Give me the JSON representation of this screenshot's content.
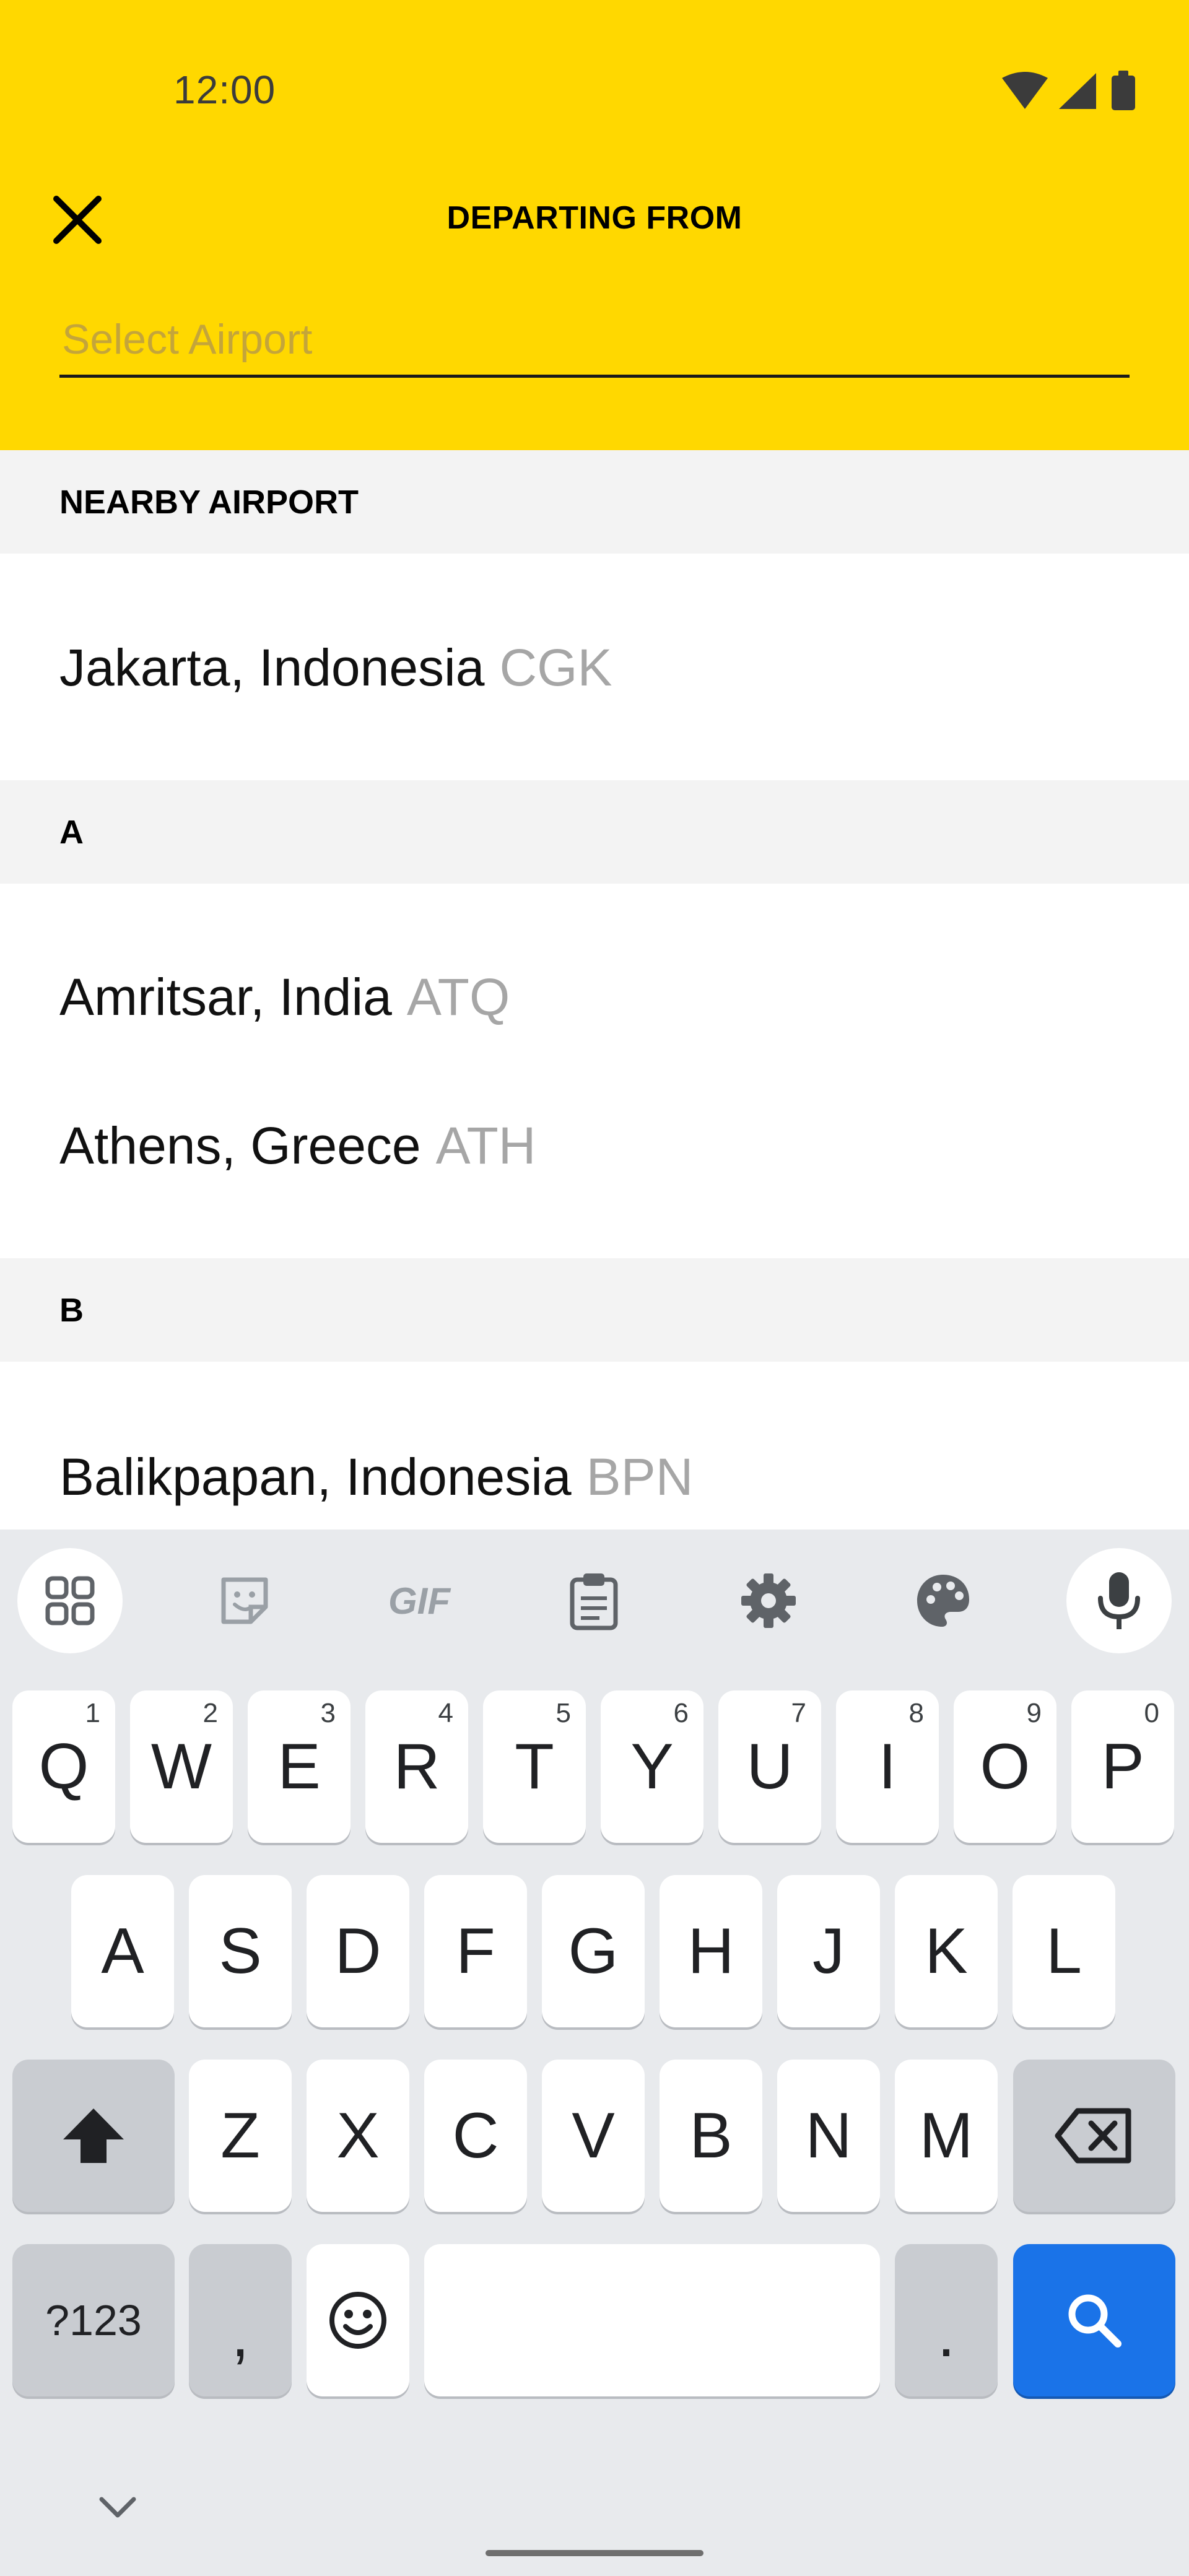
{
  "status_bar": {
    "time": "12:00"
  },
  "header": {
    "title": "DEPARTING FROM",
    "search_placeholder": "Select Airport",
    "search_value": ""
  },
  "sections": [
    {
      "label": "NEARBY AIRPORT",
      "items": [
        {
          "city": "Jakarta, Indonesia",
          "code": "CGK"
        }
      ]
    },
    {
      "label": "A",
      "items": [
        {
          "city": "Amritsar, India",
          "code": "ATQ"
        },
        {
          "city": "Athens, Greece",
          "code": "ATH"
        }
      ]
    },
    {
      "label": "B",
      "items": [
        {
          "city": "Balikpapan, Indonesia",
          "code": "BPN"
        }
      ]
    }
  ],
  "keyboard": {
    "row1": [
      {
        "key": "Q",
        "hint": "1"
      },
      {
        "key": "W",
        "hint": "2"
      },
      {
        "key": "E",
        "hint": "3"
      },
      {
        "key": "R",
        "hint": "4"
      },
      {
        "key": "T",
        "hint": "5"
      },
      {
        "key": "Y",
        "hint": "6"
      },
      {
        "key": "U",
        "hint": "7"
      },
      {
        "key": "I",
        "hint": "8"
      },
      {
        "key": "O",
        "hint": "9"
      },
      {
        "key": "P",
        "hint": "0"
      }
    ],
    "row2": [
      "A",
      "S",
      "D",
      "F",
      "G",
      "H",
      "J",
      "K",
      "L"
    ],
    "row3": [
      "Z",
      "X",
      "C",
      "V",
      "B",
      "N",
      "M"
    ],
    "symbols_label": "?123",
    "comma_label": ",",
    "period_label": ".",
    "toolbar": [
      "apps-grid-icon",
      "sticker-icon",
      "gif-icon",
      "clipboard-icon",
      "settings-gear-icon",
      "palette-icon",
      "microphone-icon"
    ],
    "gif_label": "GIF"
  },
  "colors": {
    "header_bg": "#FFD800",
    "search_key": "#1a73e8",
    "code_text": "#a6a6a6"
  }
}
